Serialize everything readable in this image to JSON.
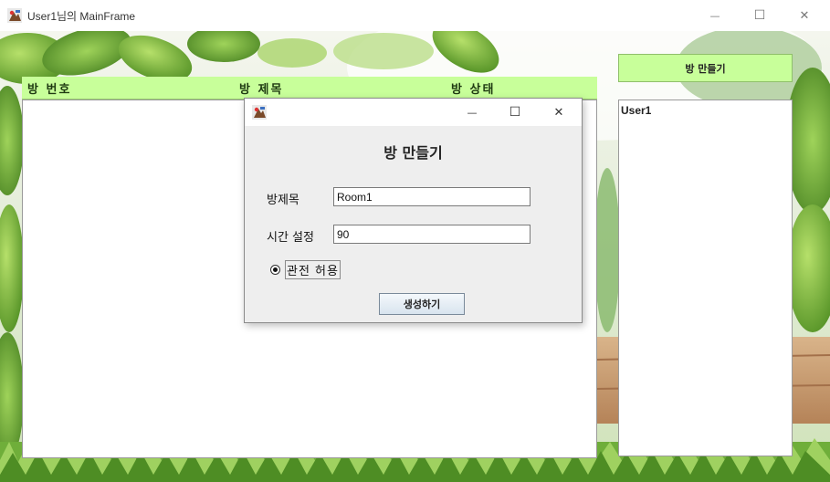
{
  "window": {
    "title": "User1님의 MainFrame",
    "minimize_glyph": "—",
    "maximize_glyph": "☐",
    "close_glyph": "✕"
  },
  "room_table": {
    "columns": [
      "방 번호",
      "방 제목",
      "방 상태"
    ]
  },
  "sidebar": {
    "make_room_label": "방 만들기",
    "users": [
      "User1"
    ]
  },
  "dialog": {
    "heading": "방 만들기",
    "title_label": "방제목",
    "title_value": "Room1",
    "time_label": "시간 설정",
    "time_value": "90",
    "spectate_label": "관전 허용",
    "spectate_checked": true,
    "create_label": "생성하기",
    "minimize_glyph": "—",
    "maximize_glyph": "☐",
    "close_glyph": "✕"
  },
  "colors": {
    "header_green": "#c8ff9a",
    "leaf_green": "#5fa12f",
    "dialog_bg": "#eeeeee"
  },
  "icons": [
    "java-app-icon",
    "minimize-icon",
    "maximize-icon",
    "close-icon"
  ]
}
